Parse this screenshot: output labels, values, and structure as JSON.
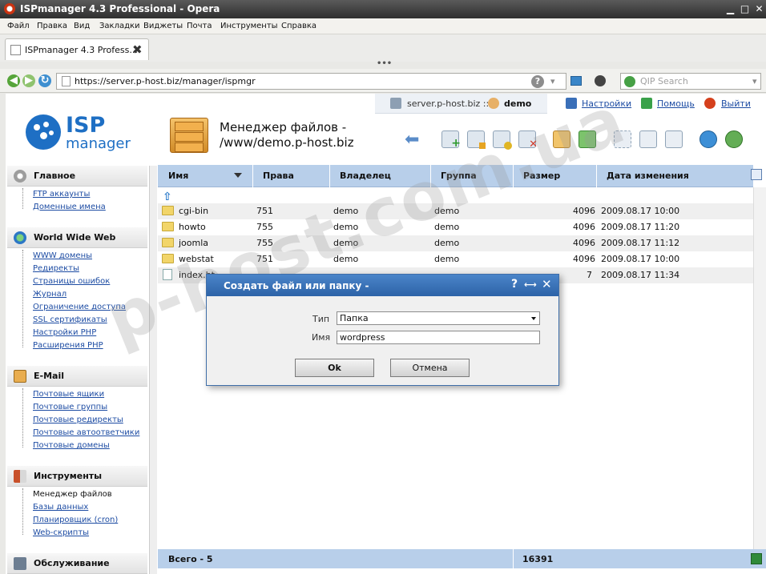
{
  "window": {
    "title": "ISPmanager 4.3 Professional - Opera"
  },
  "menubar": [
    "Файл",
    "Правка",
    "Вид",
    "Закладки",
    "Виджеты",
    "Почта",
    "Инструменты",
    "Справка"
  ],
  "tab": {
    "label": "ISPmanager 4.3 Profess..."
  },
  "address": {
    "url": "https://server.p-host.biz/manager/ispmgr"
  },
  "search": {
    "placeholder": "QIP Search"
  },
  "topbar": {
    "server": "server.p-host.biz ::",
    "user": "demo",
    "settings": "Настройки",
    "help": "Помощь",
    "logout": "Выйти"
  },
  "logo": {
    "line1": "ISP",
    "line2": "manager"
  },
  "page_title": {
    "line1": "Менеджер файлов -",
    "line2": "/www/demo.p-host.biz"
  },
  "sidebar": {
    "groups": [
      {
        "label": "Главное",
        "items": [
          "FTP аккаунты",
          "Доменные имена"
        ]
      },
      {
        "label": "World Wide Web",
        "items": [
          "WWW домены",
          "Редиректы",
          "Страницы ошибок",
          "Журнал",
          "Ограничение доступа",
          "SSL сертификаты",
          "Настройки PHP",
          "Расширения PHP"
        ]
      },
      {
        "label": "E-Mail",
        "items": [
          "Почтовые ящики",
          "Почтовые группы",
          "Почтовые редиректы",
          "Почтовые автоответчики",
          "Почтовые домены"
        ]
      },
      {
        "label": "Инструменты",
        "items": [
          "Менеджер файлов",
          "Базы данных",
          "Планировщик (cron)",
          "Web-скрипты"
        ]
      },
      {
        "label": "Обслуживание",
        "items": []
      }
    ]
  },
  "table": {
    "columns": [
      "Имя",
      "Права",
      "Владелец",
      "Группа",
      "Размер",
      "Дата изменения"
    ],
    "rows": [
      [
        "cgi-bin",
        "751",
        "demo",
        "demo",
        "4096",
        "2009.08.17 10:00"
      ],
      [
        "howto",
        "755",
        "demo",
        "demo",
        "4096",
        "2009.08.17 11:20"
      ],
      [
        "joomla",
        "755",
        "demo",
        "demo",
        "4096",
        "2009.08.17 11:12"
      ],
      [
        "webstat",
        "751",
        "demo",
        "demo",
        "4096",
        "2009.08.17 10:00"
      ],
      [
        "index.ht",
        "",
        "",
        "",
        "7",
        "2009.08.17 11:34"
      ]
    ],
    "footer": {
      "total": "Всего - 5",
      "size": "16391"
    }
  },
  "watermark": "p-host.com.ua",
  "dialog": {
    "title": "Создать файл или папку -",
    "type_label": "Тип",
    "type_value": "Папка",
    "name_label": "Имя",
    "name_value": "wordpress",
    "ok": "Ok",
    "cancel": "Отмена"
  }
}
